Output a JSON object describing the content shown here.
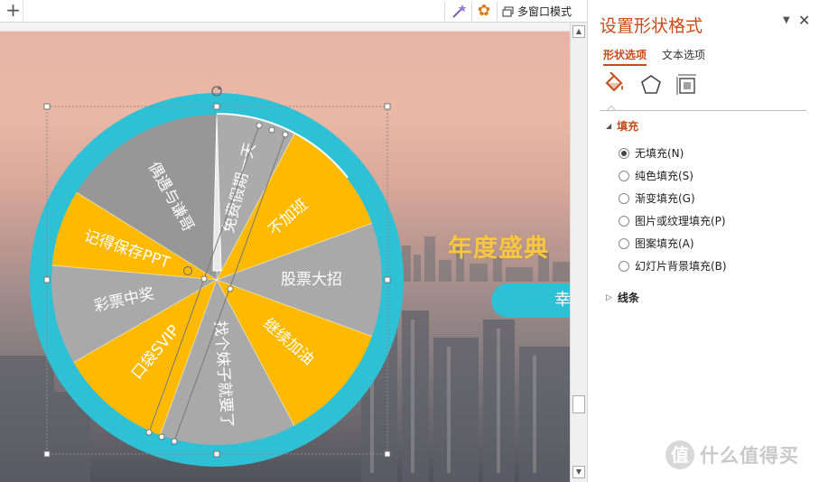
{
  "topbar": {
    "new_tab_label": "+",
    "gear_glyph": "✿",
    "multi_window_label": "多窗口模式"
  },
  "slide": {
    "title": "年度盛典",
    "lucky_button_label": "幸",
    "colors": {
      "cyan": "#2ec1d6",
      "yellow": "#ffba00",
      "gray": "#a9a9a9",
      "title": "#f9c63f"
    }
  },
  "wheel": {
    "segments": [
      {
        "label": "偶遇与谦哥",
        "fill": "#979797"
      },
      {
        "label": "免费假期一天",
        "fill": "#ababab"
      },
      {
        "label": "不加班",
        "fill": "#ffba00"
      },
      {
        "label": "股票大招",
        "fill": "#a9a9a9"
      },
      {
        "label": "继续加油",
        "fill": "#ffba00"
      },
      {
        "label": "找个妹子就要了",
        "fill": "#a9a9a9"
      },
      {
        "label": "口袋SVIP",
        "fill": "#ffba00"
      },
      {
        "label": "彩票中奖",
        "fill": "#a9a9a9"
      },
      {
        "label": "记得保存PPT",
        "fill": "#ffba00"
      }
    ]
  },
  "scrollbar": {
    "up": "▲",
    "down": "▼"
  },
  "pane": {
    "title": "设置形状格式",
    "dropdown_glyph": "▼",
    "close_glyph": "✕",
    "tabs": {
      "shape": "形状选项",
      "text": "文本选项"
    },
    "fill_section": {
      "arrow": "◢",
      "label": "填充"
    },
    "fill_options": [
      {
        "label": "无填充(N)",
        "selected": true
      },
      {
        "label": "纯色填充(S)",
        "selected": false
      },
      {
        "label": "渐变填充(G)",
        "selected": false
      },
      {
        "label": "图片或纹理填充(P)",
        "selected": false
      },
      {
        "label": "图案填充(A)",
        "selected": false
      },
      {
        "label": "幻灯片背景填充(B)",
        "selected": false
      }
    ],
    "line_section": {
      "arrow": "▷",
      "label": "线条"
    }
  },
  "watermark": {
    "logo": "值",
    "text": "什么值得买"
  }
}
